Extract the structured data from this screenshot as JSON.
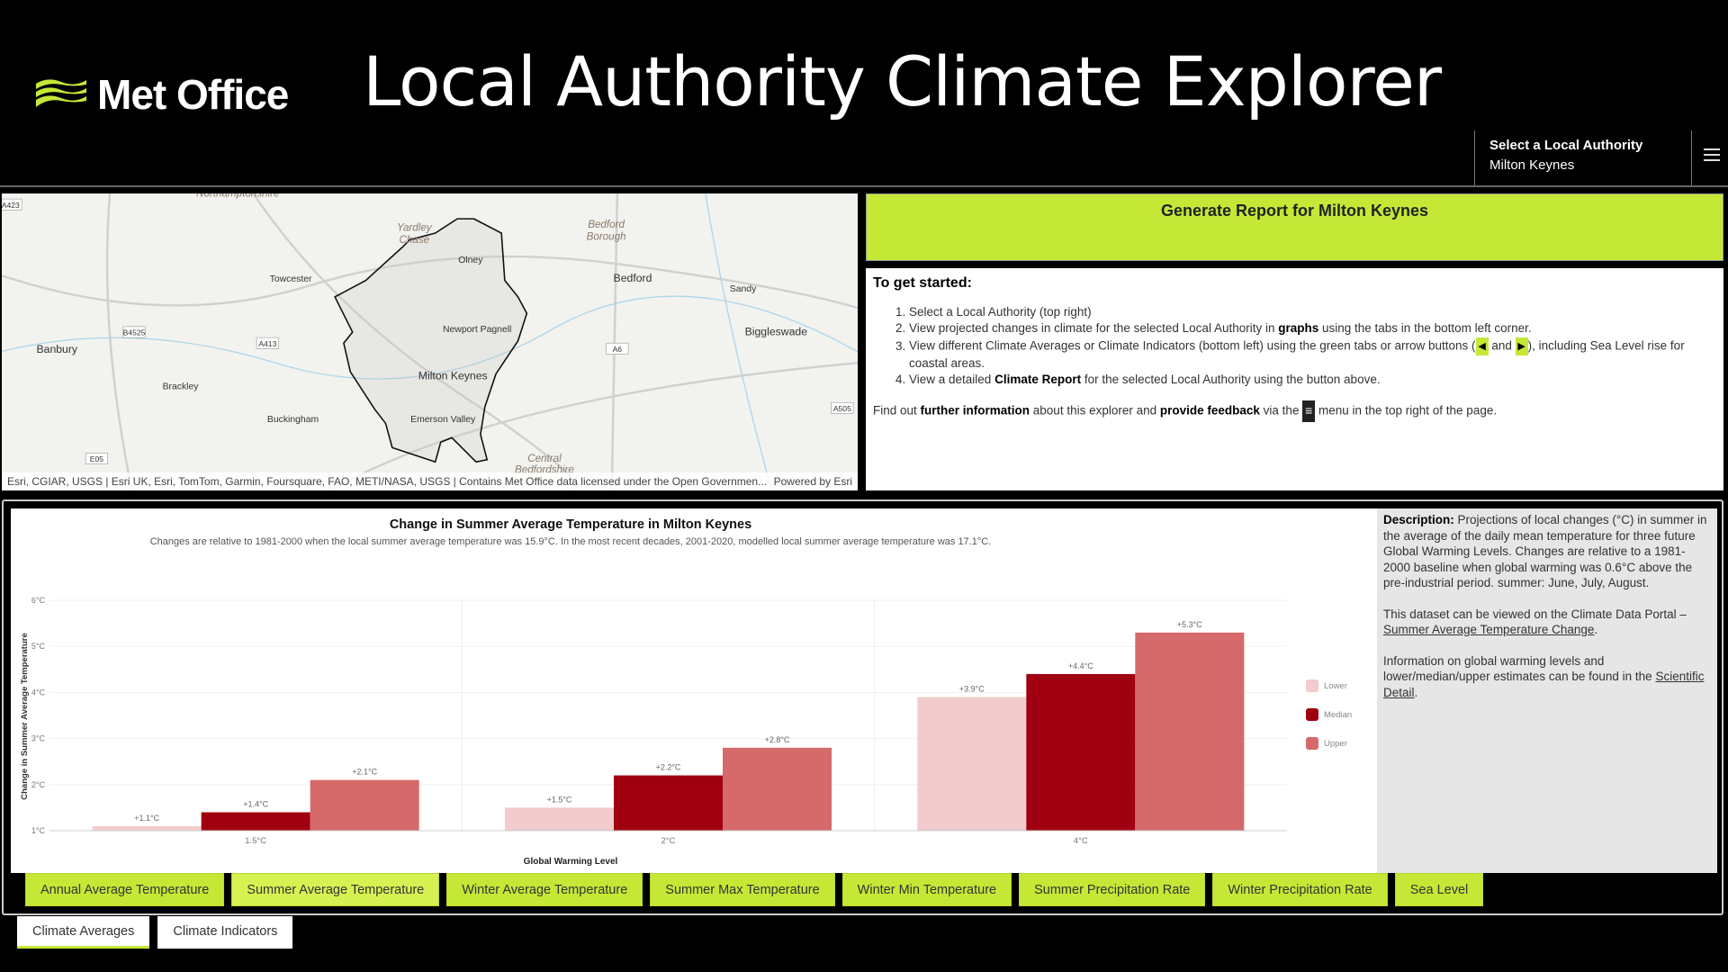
{
  "header": {
    "brand": "Met Office",
    "title": "Local Authority Climate Explorer",
    "select_label": "Select a Local Authority",
    "select_value": "Milton Keynes",
    "menu_icon": "hamburger-icon",
    "accent": "#c5e836"
  },
  "map": {
    "labels": [
      "Northamptonshire",
      "Yardley",
      "Chase",
      "Bedford",
      "Borough",
      "Olney",
      "Towcester",
      "Bedford",
      "Sandy",
      "Biggleswade",
      "Newport Pagnell",
      "Banbury",
      "Milton Keynes",
      "Brackley",
      "Buckingham",
      "Emerson Valley",
      "Central",
      "Bedfordshire"
    ],
    "roads": [
      "A423",
      "B4525",
      "A413",
      "A6",
      "A505",
      "E05"
    ],
    "attribution": "Esri, CGIAR, USGS | Esri UK, Esri, TomTom, Garmin, Foursquare, FAO, METI/NASA, USGS | Contains Met Office data licensed under the Open Governmen...",
    "powered": "Powered by Esri"
  },
  "report_button": "Generate Report for Milton Keynes",
  "start": {
    "heading": "To get started:",
    "s1": "Select a Local Authority (top right)",
    "s2a": "View projected changes in climate for the selected Local Authority in ",
    "s2b": "graphs",
    "s2c": " using the tabs in the bottom left corner.",
    "s3a": "View different Climate Averages or Climate Indicators (bottom left) using the green tabs or arrow buttons (",
    "s3b": " and ",
    "s3c": "), including Sea Level rise for coastal areas.",
    "s4a": "View a detailed ",
    "s4b": "Climate Report",
    "s4c": " for the selected Local Authority using the button above.",
    "fa": "Find out ",
    "fb": "further information",
    "fc": " about this explorer and ",
    "fd": "provide feedback",
    "fe": " via the ",
    "ff": " menu in the top right of the page."
  },
  "description": {
    "label": "Description:",
    "text": " Projections of local changes (°C) in summer in the average of the daily mean temperature for three future Global Warming Levels. Changes are relative to a 1981-2000 baseline when global warming was 0.6°C above the pre-industrial period. summer: June, July, August.",
    "portal": "This dataset can be viewed on the Climate Data Portal – ",
    "portal_link": "Summer Average Temperature Change",
    "portal_end": ".",
    "info": "Information on global warming levels and lower/median/upper estimates can be found in the ",
    "info_link": "Scientific Detail",
    "info_end": "."
  },
  "tabs": [
    "Annual Average Temperature",
    "Summer Average Temperature",
    "Winter Average Temperature",
    "Summer Max Temperature",
    "Winter Min Temperature",
    "Summer Precipitation Rate",
    "Winter Precipitation Rate",
    "Sea Level"
  ],
  "active_tab": 1,
  "bottom_tabs": [
    "Climate Averages",
    "Climate Indicators"
  ],
  "chart_data": {
    "type": "bar",
    "title": "Change in Summer Average Temperature in Milton Keynes",
    "subtitle": "Changes are relative to 1981-2000 when the local summer average temperature was 15.9°C. In the most recent decades, 2001-2020, modelled local summer average temperature was 17.1°C.",
    "xlabel": "Global Warming Level",
    "ylabel": "Change in Summer Average Temperature",
    "categories": [
      "1.5°C",
      "2°C",
      "4°C"
    ],
    "ylim": [
      1,
      6
    ],
    "yticks": [
      "1°C",
      "2°C",
      "3°C",
      "4°C",
      "5°C",
      "6°C"
    ],
    "series": [
      {
        "name": "Lower",
        "values": [
          1.1,
          1.5,
          3.9
        ],
        "labels": [
          "+1.1°C",
          "+1.5°C",
          "+3.9°C"
        ],
        "color": "#f2cbcc"
      },
      {
        "name": "Median",
        "values": [
          1.4,
          2.2,
          4.4
        ],
        "labels": [
          "+1.4°C",
          "+2.2°C",
          "+4.4°C"
        ],
        "color": "#a00010"
      },
      {
        "name": "Upper",
        "values": [
          2.1,
          2.8,
          5.3
        ],
        "labels": [
          "+2.1°C",
          "+2.8°C",
          "+5.3°C"
        ],
        "color": "#d6696a"
      }
    ],
    "legend": "right",
    "grid": true
  }
}
